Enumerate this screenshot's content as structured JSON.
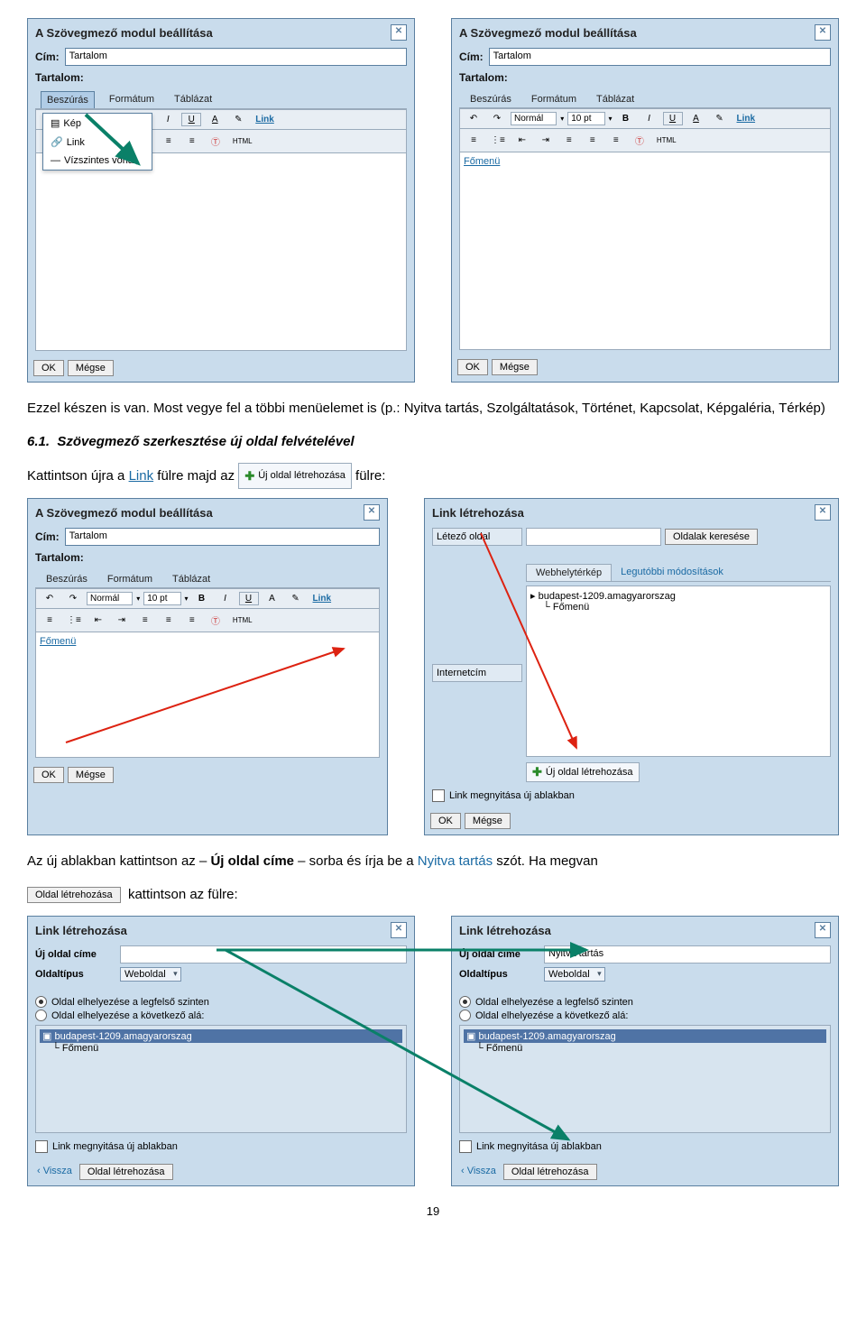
{
  "dlg1": {
    "title": "A Szövegmező modul beállítása",
    "cim_label": "Cím:",
    "cim_value": "Tartalom",
    "tartalom_label": "Tartalom:",
    "tabs": {
      "insert": "Beszúrás",
      "format": "Formátum",
      "table": "Táblázat"
    },
    "menu": {
      "image": "Kép",
      "link": "Link",
      "hr": "Vízszintes vonal"
    },
    "normal": "Normál",
    "fontsize": "10 pt",
    "ok": "OK",
    "cancel": "Mégse",
    "fomenu": "Főmenü"
  },
  "para1": "Ezzel készen is van. Most vegye fel a többi menüelemet is (p.: Nyitva tartás, Szolgáltatások, Történet, Kapcsolat, Képgaléria, Térkép)",
  "heading": {
    "num": "6.1.",
    "text": "Szövegmező szerkesztése új oldal felvételével"
  },
  "para2a": "Kattintson újra a ",
  "para2b": " fülre majd az ",
  "para2c": " fülre:",
  "link_word": "Link",
  "chip_uj": "Új oldal létrehozása",
  "linkdlg": {
    "title": "Link létrehozása",
    "existing": "Létező oldal",
    "search_btn": "Oldalak keresése",
    "internet": "Internetcím",
    "tab1": "Webhelytérkép",
    "tab2": "Legutóbbi módosítások",
    "site": "budapest-1209.amagyarorszag",
    "fomenu": "Főmenü",
    "newpage": "Új oldal létrehozása",
    "open_new": "Link megnyitása új ablakban",
    "ok": "OK",
    "cancel": "Mégse"
  },
  "para3a": "Az új ablakban kattintson az – ",
  "para3b": "Új oldal címe",
  "para3c": " – sorba és írja be a ",
  "para3d": "Nyitva tartás",
  "para3e": " szót. Ha megvan",
  "para4a": "kattintson az  fülre:",
  "btn_create": "Oldal létrehozása",
  "newdlg": {
    "title": "Link létrehozása",
    "new_title_label": "Új oldal címe",
    "type_label": "Oldaltípus",
    "type_value": "Weboldal",
    "nyitva": "Nyitva tartás",
    "opt1": "Oldal elhelyezése a legfelső szinten",
    "opt2": "Oldal elhelyezése a következő alá:",
    "site": "budapest-1209.amagyarorszag",
    "fomenu": "Főmenü",
    "open_new": "Link megnyitása új ablakban",
    "back": "‹ Vissza",
    "create": "Oldal létrehozása"
  },
  "pagenum": "19"
}
